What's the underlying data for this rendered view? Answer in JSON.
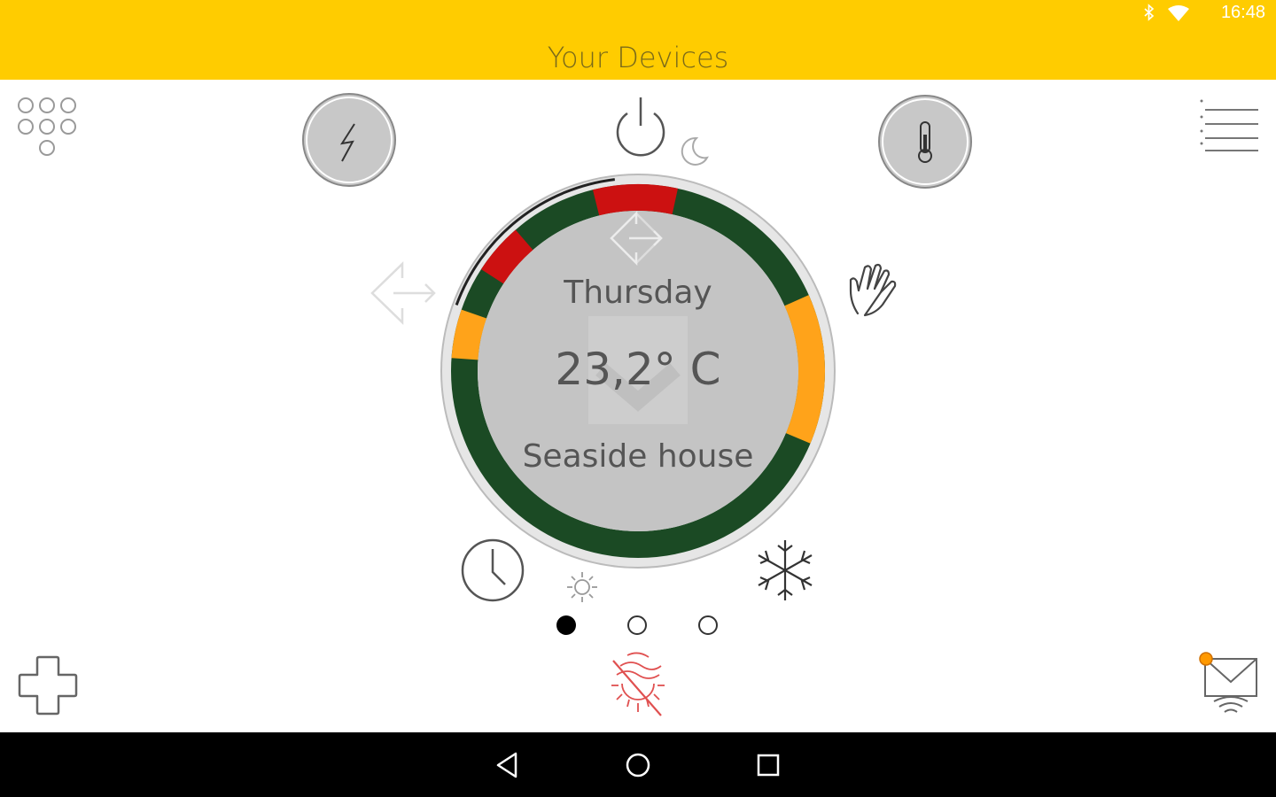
{
  "status_bar": {
    "time": "16:48",
    "icons": [
      "bluetooth-icon",
      "wifi-icon"
    ]
  },
  "header": {
    "title": "Your Devices"
  },
  "thermostat": {
    "day": "Thursday",
    "temperature": "23,2° C",
    "location": "Seaside house",
    "ring_colors": {
      "green": "#1b4a24",
      "red": "#cc1111",
      "orange": "#ffa31a"
    }
  },
  "pager": {
    "pages": 3,
    "active_index": 0
  },
  "colors": {
    "accent": "#ffcc00",
    "notification": "#ff9900",
    "heating_off": "#e05050"
  },
  "icons": [
    "grid-icon",
    "lightning-icon",
    "power-icon",
    "moon-icon",
    "thermometer-icon",
    "menu-icon",
    "exit-icon",
    "hand-icon",
    "clock-icon",
    "sun-icon",
    "snowflake-icon",
    "plus-icon",
    "heating-off-icon",
    "mail-icon",
    "back-icon",
    "home-icon",
    "recents-icon"
  ]
}
